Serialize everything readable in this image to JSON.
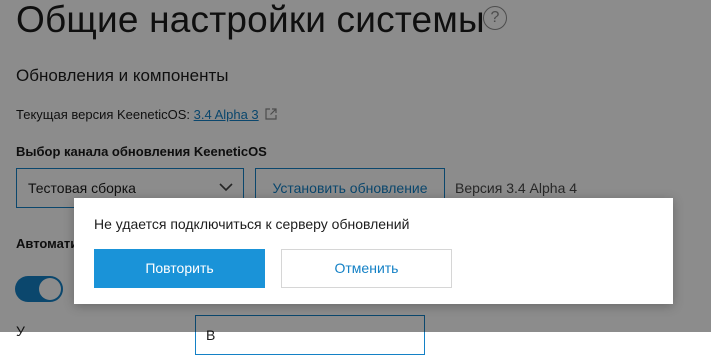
{
  "page": {
    "title": "Общие настройки системы",
    "help_icon": "question-circle-icon",
    "help_glyph": "?"
  },
  "updates": {
    "section_title": "Обновления и компоненты",
    "current_version_label": "Текущая версия KeeneticOS:",
    "current_version_link": "3.4 Alpha 3",
    "channel_label": "Выбор канала обновления KeeneticOS",
    "channel_selected": "Тестовая сборка",
    "install_button": "Установить обновление",
    "available_version": "Версия 3.4 Alpha 4",
    "auto_label": "Автомати",
    "auto_enabled": true,
    "bottom_label": "У",
    "bottom_select_value": "В"
  },
  "dialog": {
    "message": "Не удается подключиться к серверу обновлений",
    "retry_button": "Повторить",
    "cancel_button": "Отменить"
  },
  "colors": {
    "accent": "#1481c6",
    "primary_button": "#1a93d8",
    "overlay": "rgba(0,0,0,0.45)"
  }
}
